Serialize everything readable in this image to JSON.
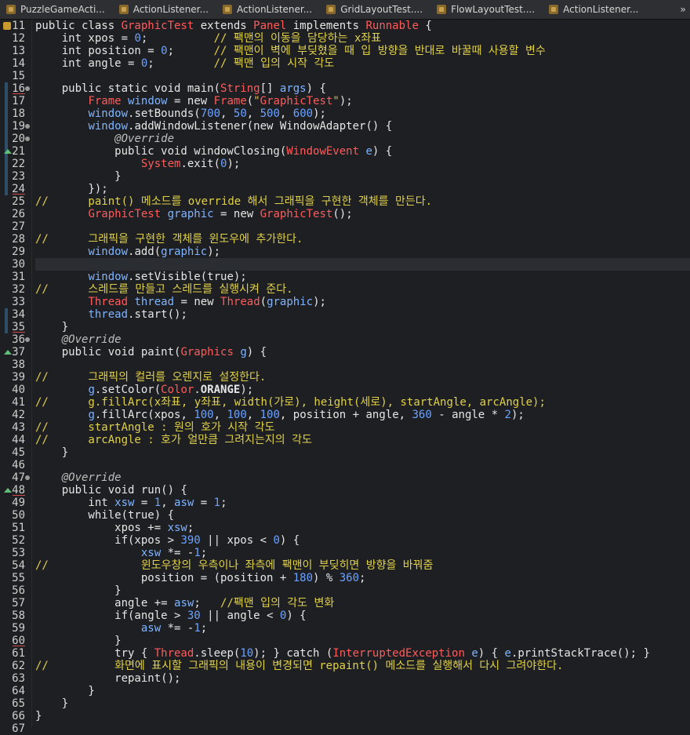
{
  "tabs": [
    {
      "label": "PuzzleGameActi...",
      "icon": "java-file-icon"
    },
    {
      "label": "ActionListener...",
      "icon": "java-file-icon"
    },
    {
      "label": "ActionListener...",
      "icon": "java-file-icon"
    },
    {
      "label": "GridLayoutTest....",
      "icon": "java-file-icon"
    },
    {
      "label": "FlowLayoutTest....",
      "icon": "java-file-icon"
    },
    {
      "label": "ActionListener...",
      "icon": "java-file-icon"
    }
  ],
  "tab_menu_label": "»",
  "lines": [
    {
      "n": 11,
      "text": "public class GraphicTest extends Panel implements Runnable {"
    },
    {
      "n": 12,
      "text": "    int xpos = 0;          // 팩맨의 이동을 담당하는 x좌표"
    },
    {
      "n": 13,
      "text": "    int position = 0;      // 팩맨이 벽에 부딪혔을 때 입 방향을 반대로 바꿀때 사용할 변수"
    },
    {
      "n": 14,
      "text": "    int angle = 0;         // 팩맨 입의 시작 각도"
    },
    {
      "n": 15,
      "text": ""
    },
    {
      "n": 16,
      "text": "    public static void main(String[] args) {"
    },
    {
      "n": 17,
      "text": "        Frame window = new Frame(\"GraphicTest\");"
    },
    {
      "n": 18,
      "text": "        window.setBounds(700, 50, 500, 600);"
    },
    {
      "n": 19,
      "text": "        window.addWindowListener(new WindowAdapter() {"
    },
    {
      "n": 20,
      "text": "            @Override"
    },
    {
      "n": 21,
      "text": "            public void windowClosing(WindowEvent e) {"
    },
    {
      "n": 22,
      "text": "                System.exit(0);"
    },
    {
      "n": 23,
      "text": "            }"
    },
    {
      "n": 24,
      "text": "        });"
    },
    {
      "n": 25,
      "text": "//      paint() 메소드를 override 해서 그래픽을 구현한 객체를 만든다."
    },
    {
      "n": 26,
      "text": "        GraphicTest graphic = new GraphicTest();"
    },
    {
      "n": 27,
      "text": ""
    },
    {
      "n": 28,
      "text": "//      그래픽을 구현한 객체를 윈도우에 추가한다."
    },
    {
      "n": 29,
      "text": "        window.add(graphic);"
    },
    {
      "n": 30,
      "text": ""
    },
    {
      "n": 31,
      "text": "        window.setVisible(true);"
    },
    {
      "n": 32,
      "text": "//      스레드를 만들고 스레드를 실행시켜 준다."
    },
    {
      "n": 33,
      "text": "        Thread thread = new Thread(graphic);"
    },
    {
      "n": 34,
      "text": "        thread.start();"
    },
    {
      "n": 35,
      "text": "    }"
    },
    {
      "n": 36,
      "text": "    @Override"
    },
    {
      "n": 37,
      "text": "    public void paint(Graphics g) {"
    },
    {
      "n": 38,
      "text": ""
    },
    {
      "n": 39,
      "text": "//      그래픽의 컬러를 오렌지로 설정한다."
    },
    {
      "n": 40,
      "text": "        g.setColor(Color.ORANGE);"
    },
    {
      "n": 41,
      "text": "//      g.fillArc(x좌표, y좌표, width(가로), height(세로), startAngle, arcAngle);"
    },
    {
      "n": 42,
      "text": "        g.fillArc(xpos, 100, 100, 100, position + angle, 360 - angle * 2);"
    },
    {
      "n": 43,
      "text": "//      startAngle : 원의 호가 시작 각도"
    },
    {
      "n": 44,
      "text": "//      arcAngle : 호가 얼만큼 그려지는지의 각도"
    },
    {
      "n": 45,
      "text": "    }"
    },
    {
      "n": 46,
      "text": ""
    },
    {
      "n": 47,
      "text": "    @Override"
    },
    {
      "n": 48,
      "text": "    public void run() {"
    },
    {
      "n": 49,
      "text": "        int xsw = 1, asw = 1;"
    },
    {
      "n": 50,
      "text": "        while(true) {"
    },
    {
      "n": 51,
      "text": "            xpos += xsw;"
    },
    {
      "n": 52,
      "text": "            if(xpos > 390 || xpos < 0) {"
    },
    {
      "n": 53,
      "text": "                xsw *= -1;"
    },
    {
      "n": 54,
      "text": "//              윈도우창의 우측이나 좌측에 팩맨이 부딪히면 방향을 바꿔줌"
    },
    {
      "n": 55,
      "text": "                position = (position + 180) % 360;"
    },
    {
      "n": 56,
      "text": "            }"
    },
    {
      "n": 57,
      "text": "            angle += asw;   //팩맨 입의 각도 변화"
    },
    {
      "n": 58,
      "text": "            if(angle > 30 || angle < 0) {"
    },
    {
      "n": 59,
      "text": "                asw *= -1;"
    },
    {
      "n": 60,
      "text": "            }"
    },
    {
      "n": 61,
      "text": "            try { Thread.sleep(10); } catch (InterruptedException e) { e.printStackTrace(); }"
    },
    {
      "n": 62,
      "text": "//          화면에 표시할 그래픽의 내용이 변경되면 repaint() 메소드를 실행해서 다시 그려야한다."
    },
    {
      "n": 63,
      "text": "            repaint();"
    },
    {
      "n": 64,
      "text": "        }"
    },
    {
      "n": 65,
      "text": "    }"
    },
    {
      "n": 66,
      "text": "}"
    },
    {
      "n": 67,
      "text": ""
    }
  ]
}
